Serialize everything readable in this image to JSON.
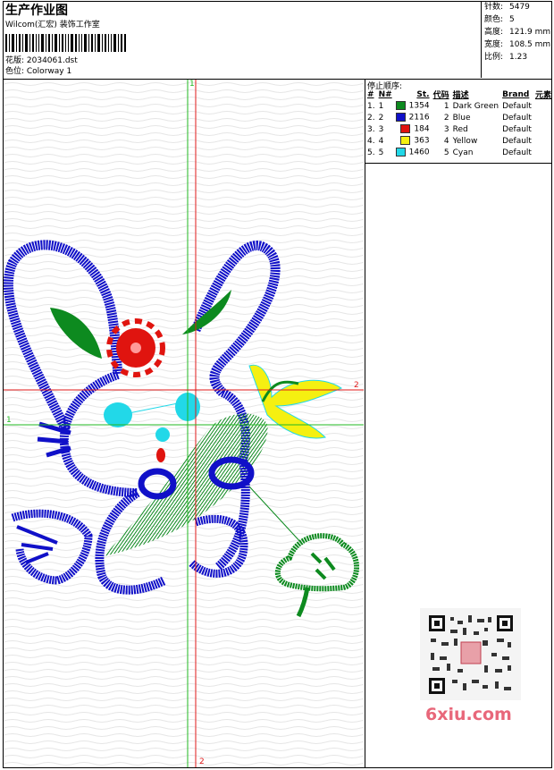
{
  "header": {
    "title": "生产作业图",
    "company": "Wilcom(汇宏) 装饰工作室",
    "design_label": "花版: 2034061.dst",
    "colorway_label": "色位: Colorway 1"
  },
  "stats": [
    {
      "key": "针数:",
      "value": "5479"
    },
    {
      "key": "颜色:",
      "value": "5"
    },
    {
      "key": "高度:",
      "value": "121.9 mm"
    },
    {
      "key": "宽度:",
      "value": "108.5 mm"
    },
    {
      "key": "比例:",
      "value": "1.23"
    }
  ],
  "stop_sequence": {
    "title": "停止顺序:",
    "columns": [
      "#",
      "N#",
      "St.",
      "代码",
      "描述",
      "Brand",
      "元素"
    ],
    "rows": [
      {
        "idx": "1.",
        "n": "1",
        "color": "#0d8a1f",
        "stitches": "1354",
        "code": "1",
        "desc": "Dark Green",
        "brand": "Default"
      },
      {
        "idx": "2.",
        "n": "2",
        "color": "#1010c8",
        "stitches": "2116",
        "code": "2",
        "desc": "Blue",
        "brand": "Default"
      },
      {
        "idx": "3.",
        "n": "3",
        "color": "#e0140f",
        "stitches": "184",
        "code": "3",
        "desc": "Red",
        "brand": "Default"
      },
      {
        "idx": "4.",
        "n": "4",
        "color": "#f5f011",
        "stitches": "363",
        "code": "4",
        "desc": "Yellow",
        "brand": "Default"
      },
      {
        "idx": "5.",
        "n": "5",
        "color": "#22d8e8",
        "stitches": "1460",
        "code": "5",
        "desc": "Cyan",
        "brand": "Default"
      }
    ]
  },
  "axis_labels": {
    "v_top": "1",
    "v_bottom": "2",
    "h_left": "1",
    "h_right": "2"
  },
  "watermark": "6xiu.com"
}
